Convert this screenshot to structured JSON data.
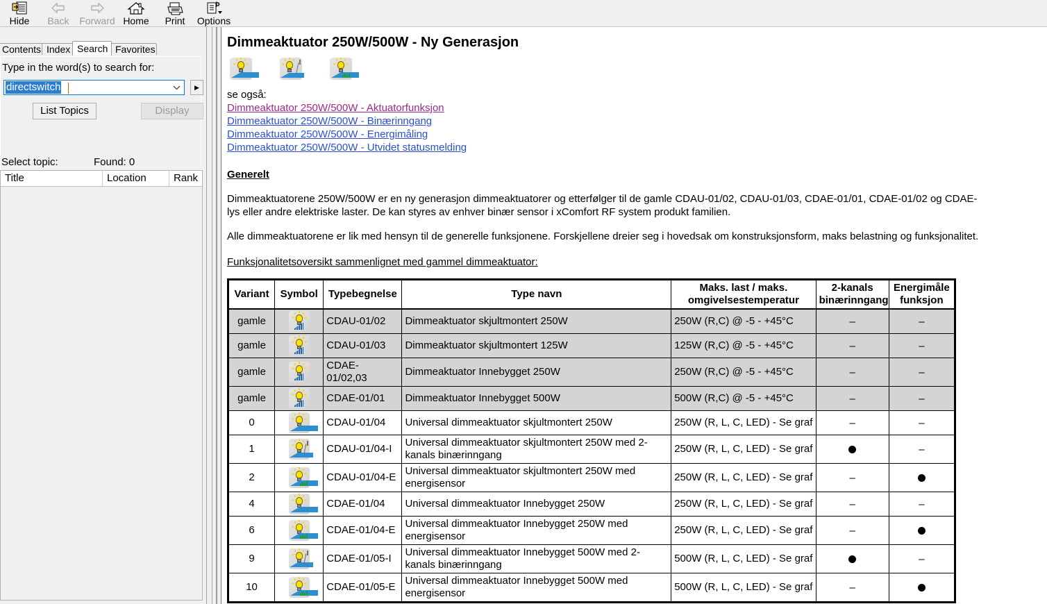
{
  "toolbar": {
    "buttons": [
      {
        "label": "Hide",
        "icon": "hide-pane-icon",
        "disabled": false
      },
      {
        "label": "Back",
        "icon": "back-arrow-icon",
        "disabled": true
      },
      {
        "label": "Forward",
        "icon": "forward-arrow-icon",
        "disabled": true
      },
      {
        "label": "Home",
        "icon": "home-icon",
        "disabled": false
      },
      {
        "label": "Print",
        "icon": "printer-icon",
        "disabled": false
      },
      {
        "label": "Options",
        "icon": "options-icon",
        "disabled": false
      }
    ]
  },
  "left_pane": {
    "tabs": [
      {
        "label": "Contents",
        "active": false
      },
      {
        "label": "Index",
        "active": false
      },
      {
        "label": "Search",
        "active": true
      },
      {
        "label": "Favorites",
        "active": false
      }
    ],
    "search": {
      "prompt": "Type in the word(s) to search for:",
      "query_value": "directswitch",
      "query_placeholder": "",
      "dropdown_caret": "chevron-down-icon",
      "go_button": "▶",
      "list_topics_label": "List Topics",
      "display_label": "Display",
      "select_topic_label": "Select topic:",
      "found_label": "Found: 0",
      "columns": [
        "Title",
        "Location",
        "Rank"
      ],
      "rows": []
    }
  },
  "content": {
    "title": "Dimmeaktuator 250W/500W - Ny Generasjon",
    "header_icons": [
      {
        "name": "dimmer-lamp-icon"
      },
      {
        "name": "dimmer-lamp-binary-input-icon"
      },
      {
        "name": "dimmer-lamp-energy-icon"
      }
    ],
    "see_also_label": "se også:",
    "links": [
      {
        "text": "Dimmeaktuator 250W/500W - Aktuatorfunksjon",
        "color": "#9c2a8e",
        "visited": true
      },
      {
        "text": "Dimmeaktuator 250W/500W - Binærinngang",
        "color": "#2a4fd4",
        "visited": false
      },
      {
        "text": "Dimmeaktuator 250W/500W - Energimåling",
        "color": "#2a4fd4",
        "visited": false
      },
      {
        "text": "Dimmeaktuator 250W/500W - Utvidet statusmelding",
        "color": "#2a4fd4",
        "visited": false
      }
    ],
    "section_heading": "Generelt",
    "paragraph_1": "Dimmeaktuatorene 250W/500W er en ny generasjon dimmeaktuatorer og etterfølger til de gamle CDAU-01/02, CDAU-01/03, CDAE-01/01, CDAE-01/02 og CDAE-\nlys eller andre elektriske laster. De kan styres av enhver binær sensor i xComfort RF system produkt familien.",
    "paragraph_2": "Alle dimmeaktuatorene er lik med hensyn til de generelle funksjonene. Forskjellene dreier seg i hovedsak om konstruksjonsform, maks belastning og funksjonalitet.",
    "table_caption": "Funksjonalitetsoversikt sammenlignet med gammel dimmeaktuator:",
    "table": {
      "columns": [
        "Variant",
        "Symbol",
        "Typebegnelse",
        "Type navn",
        "Maks. last / maks. omgivelsestemperatur",
        "2-kanals binærinngang",
        "Energimåle funksjon"
      ],
      "rows": [
        {
          "variant": "gamle",
          "symbol": "lamp-bars",
          "type_code": "CDAU-01/02",
          "type_name": "Dimmeaktuator skjultmontert 250W",
          "load": "250W (R,C) @ -5 - +45°C",
          "binary": "–",
          "energy": "–",
          "old": true
        },
        {
          "variant": "gamle",
          "symbol": "lamp-bars",
          "type_code": "CDAU-01/03",
          "type_name": "Dimmeaktuator skjultmontert 125W",
          "load": "125W (R,C) @ -5 - +45°C",
          "binary": "–",
          "energy": "–",
          "old": true
        },
        {
          "variant": "gamle",
          "symbol": "lamp-bars",
          "type_code": "CDAE-01/02,03",
          "type_name": "Dimmeaktuator Innebygget 250W",
          "load": "250W (R,C) @ -5 - +45°C",
          "binary": "–",
          "energy": "–",
          "old": true
        },
        {
          "variant": "gamle",
          "symbol": "lamp-bars",
          "type_code": "CDAE-01/01",
          "type_name": "Dimmeaktuator Innebygget 500W",
          "load": "500W (R,C) @ -5 - +45°C",
          "binary": "–",
          "energy": "–",
          "old": true
        },
        {
          "variant": "0",
          "symbol": "lamp-ramp",
          "type_code": "CDAU-01/04",
          "type_name": "Universal dimmeaktuator skjultmontert 250W",
          "load": "250W (R, L, C, LED) - Se graf",
          "binary": "–",
          "energy": "–",
          "old": false
        },
        {
          "variant": "1",
          "symbol": "lamp-ramp-curve",
          "type_code": "CDAU-01/04-I",
          "type_name": "Universal dimmeaktuator skjultmontert 250W med 2-kanals binærinngang",
          "load": "250W (R, L, C, LED) - Se graf",
          "binary": "●",
          "energy": "–",
          "old": false
        },
        {
          "variant": "2",
          "symbol": "lamp-ramp-grass",
          "type_code": "CDAU-01/04-E",
          "type_name": "Universal dimmeaktuator skjultmontert 250W med energisensor",
          "load": "250W (R, L, C, LED) - Se graf",
          "binary": "–",
          "energy": "●",
          "old": false
        },
        {
          "variant": "4",
          "symbol": "lamp-ramp",
          "type_code": "CDAE-01/04",
          "type_name": "Universal dimmeaktuator Innebygget 250W",
          "load": "250W (R, L, C, LED) - Se graf",
          "binary": "–",
          "energy": "–",
          "old": false
        },
        {
          "variant": "6",
          "symbol": "lamp-ramp-grass",
          "type_code": "CDAE-01/04-E",
          "type_name": "Universal dimmeaktuator Innebygget 250W med energisensor",
          "load": "250W (R, L, C, LED) - Se graf",
          "binary": "–",
          "energy": "●",
          "old": false
        },
        {
          "variant": "9",
          "symbol": "lamp-ramp-curve",
          "type_code": "CDAE-01/05-I",
          "type_name": "Universal dimmeaktuator Innebygget 500W med 2-kanals binærinngang",
          "load": "500W (R, L, C, LED) - Se graf",
          "binary": "●",
          "energy": "–",
          "old": false
        },
        {
          "variant": "10",
          "symbol": "lamp-ramp-grass",
          "type_code": "CDAE-01/05-E",
          "type_name": "Universal dimmeaktuator Innebygget 500W med energisensor",
          "load": "500W (R, L, C, LED) - Se graf",
          "binary": "–",
          "energy": "●",
          "old": false
        }
      ]
    }
  },
  "colors": {
    "link": "#2a4fd4",
    "visited_link": "#9c2a8e",
    "old_row_bg": "#d4d4d4",
    "chrome_bg": "#f0f0f0",
    "selection_bg": "#2a7fd4"
  }
}
